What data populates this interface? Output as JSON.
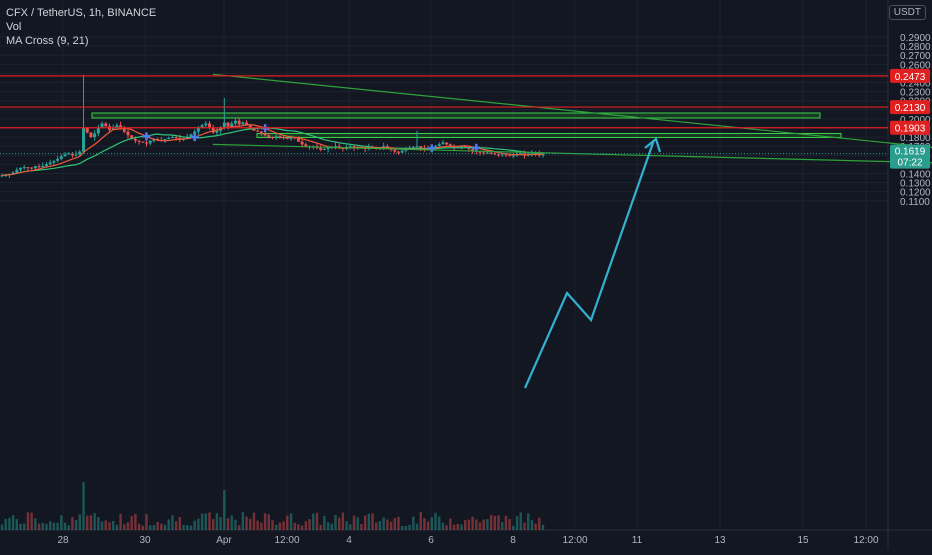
{
  "header": {
    "symbol_line": "CFX / TetherUS, 1h, BINANCE",
    "vol_label": "Vol",
    "ma_label": "MA Cross (9, 21)",
    "currency": "USDT"
  },
  "colors": {
    "background": "#131722",
    "grid": "#1e222d",
    "axis_text": "#b2b5be",
    "candle_up": "#26a69a",
    "candle_down": "#ef5350",
    "ma_fast": "#f05a3a",
    "ma_slow": "#2ec47b",
    "resistance": "#e02020",
    "zone_fill": "#1f7a2a",
    "zone_border": "#3fd04a",
    "trend": "#2ea33a",
    "projection": "#33b1d1",
    "marker": "#4d7cf0",
    "current_price_bg": "#2a9d8f"
  },
  "chart_data": {
    "type": "candlestick",
    "price_axis": {
      "ticks": [
        "0.2900",
        "0.2800",
        "0.2700",
        "0.2600",
        "0.2500",
        "0.2400",
        "0.2300",
        "0.2200",
        "0.2100",
        "0.2000",
        "0.1900",
        "0.1800",
        "0.1700",
        "0.1600",
        "0.1500",
        "0.1400",
        "0.1300",
        "0.1200",
        "0.1100"
      ],
      "range": [
        0.1035,
        0.2995
      ]
    },
    "time_axis": {
      "ticks": [
        "28",
        "30",
        "Apr",
        "12:00",
        "4",
        "6",
        "8",
        "12:00",
        "11",
        "13",
        "15",
        "12:00"
      ]
    },
    "price_lines": [
      {
        "value": 0.2473,
        "label": "0.2473"
      },
      {
        "value": 0.213,
        "label": "0.2130"
      },
      {
        "value": 0.1903,
        "label": "0.1903"
      }
    ],
    "current_price": {
      "value": 0.1619,
      "label": "0.1619",
      "countdown": "07:22"
    },
    "zones": [
      {
        "top": 0.2065,
        "bottom": 0.201
      },
      {
        "top": 0.184,
        "bottom": 0.1796
      }
    ],
    "trend_lines": [
      {
        "from": {
          "t": 2.4,
          "p": 0.249
        },
        "to": {
          "t": 13.0,
          "p": 0.152
        }
      },
      {
        "from": {
          "t": 2.4,
          "p": 0.172
        },
        "to": {
          "t": 13.5,
          "p": 0.1465
        }
      }
    ],
    "projection": [
      {
        "t": 11.5,
        "p": 0.156
      },
      {
        "t": 12.0,
        "p": 0.19
      },
      {
        "t": 12.5,
        "p": 0.181
      },
      {
        "t": 14.0,
        "p": 0.251
      }
    ],
    "candles_close": [
      0.138,
      0.1385,
      0.1395,
      0.141,
      0.144,
      0.146,
      0.147,
      0.1465,
      0.146,
      0.148,
      0.1472,
      0.1482,
      0.1502,
      0.152,
      0.154,
      0.156,
      0.159,
      0.161,
      0.162,
      0.16,
      0.161,
      0.164,
      0.19,
      0.185,
      0.18,
      0.184,
      0.19,
      0.195,
      0.192,
      0.188,
      0.19,
      0.193,
      0.19,
      0.186,
      0.182,
      0.178,
      0.176,
      0.175,
      0.174,
      0.173,
      0.176,
      0.178,
      0.177,
      0.176,
      0.178,
      0.179,
      0.18,
      0.179,
      0.177,
      0.178,
      0.18,
      0.183,
      0.186,
      0.19,
      0.193,
      0.195,
      0.19,
      0.185,
      0.187,
      0.19,
      0.196,
      0.192,
      0.195,
      0.198,
      0.194,
      0.196,
      0.193,
      0.189,
      0.187,
      0.186,
      0.184,
      0.182,
      0.18,
      0.179,
      0.181,
      0.18,
      0.179,
      0.178,
      0.18,
      0.179,
      0.175,
      0.172,
      0.17,
      0.169,
      0.17,
      0.168,
      0.166,
      0.167,
      0.168,
      0.169,
      0.17,
      0.168,
      0.167,
      0.169,
      0.17,
      0.168,
      0.169,
      0.168,
      0.167,
      0.169,
      0.168,
      0.167,
      0.169,
      0.17,
      0.168,
      0.166,
      0.164,
      0.163,
      0.165,
      0.167,
      0.168,
      0.169,
      0.17,
      0.168,
      0.167,
      0.166,
      0.168,
      0.17,
      0.172,
      0.174,
      0.172,
      0.17,
      0.169,
      0.168,
      0.17,
      0.169,
      0.167,
      0.165,
      0.164,
      0.163,
      0.162,
      0.163,
      0.162,
      0.161,
      0.16,
      0.161,
      0.16,
      0.159,
      0.16,
      0.161,
      0.162,
      0.16,
      0.162,
      0.163,
      0.162,
      0.16,
      0.1619
    ]
  }
}
